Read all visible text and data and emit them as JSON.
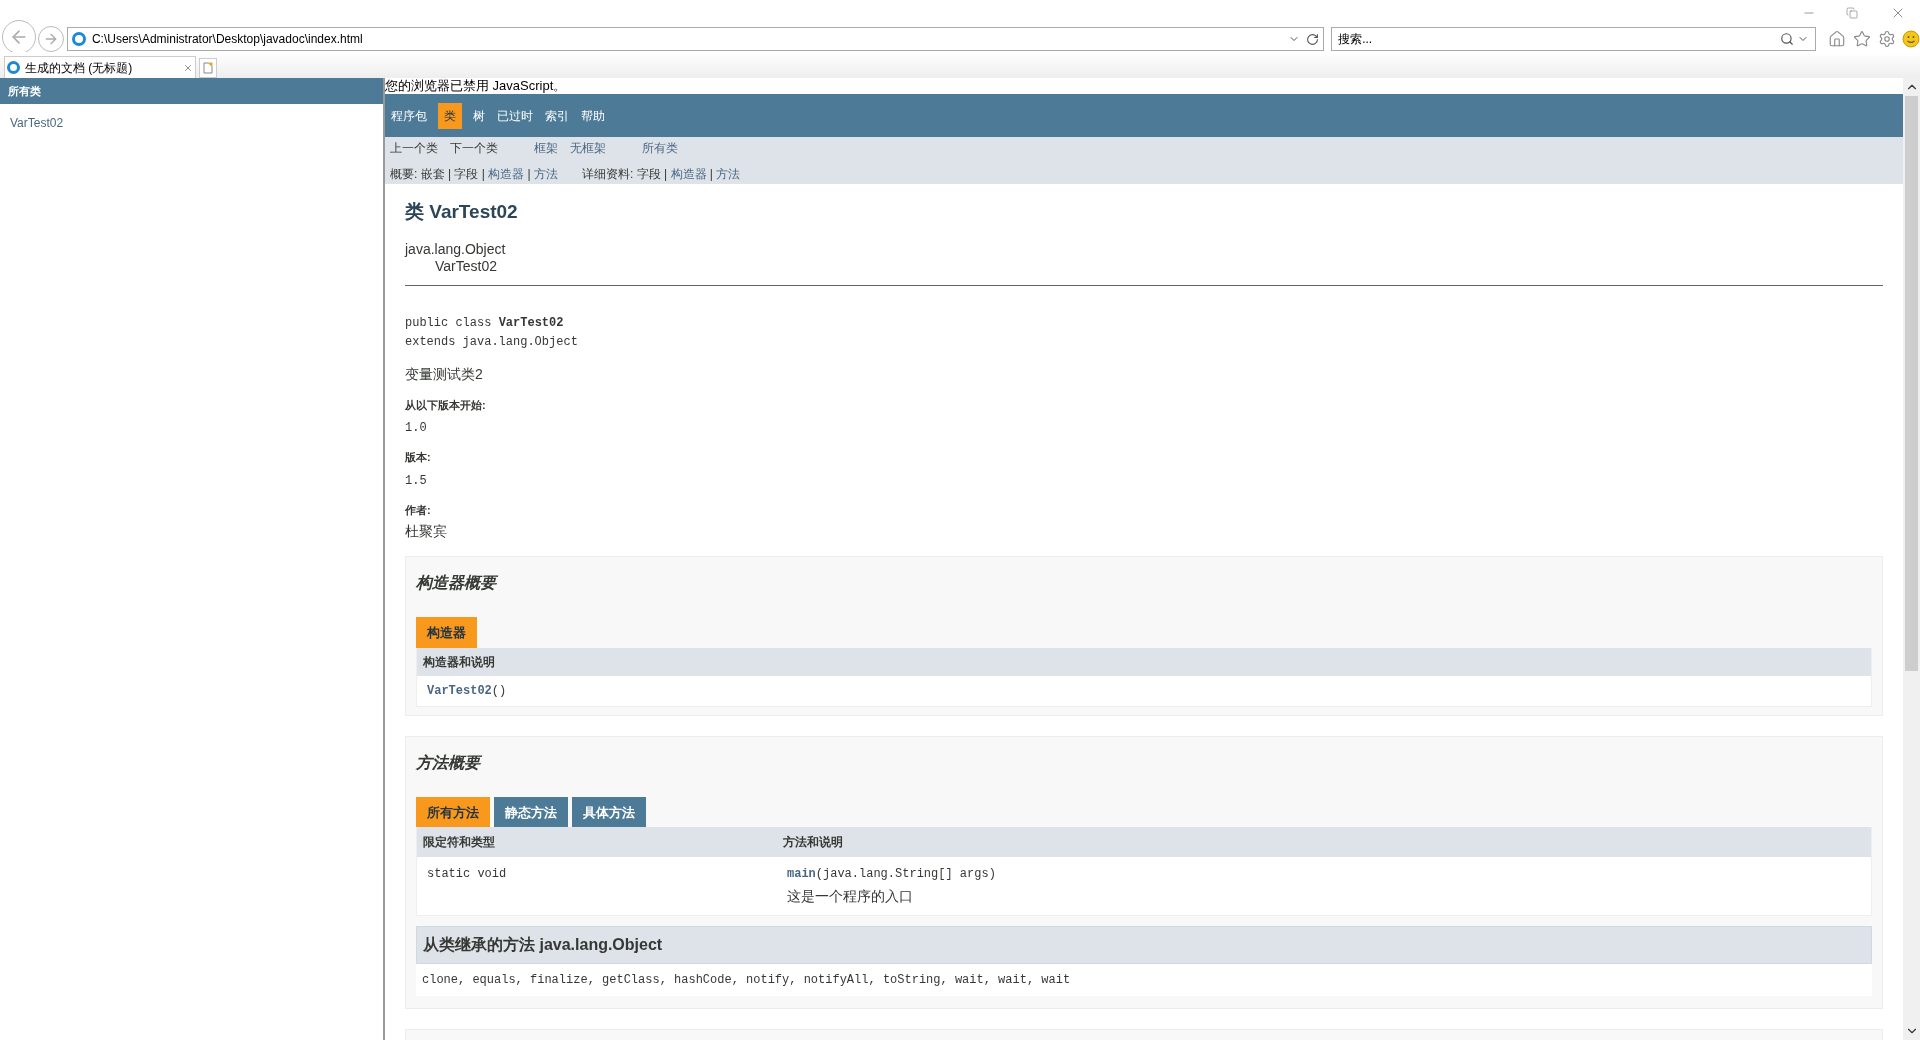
{
  "browser": {
    "address": "C:\\Users\\Administrator\\Desktop\\javadoc\\index.html",
    "search": {
      "placeholder": "搜索..."
    },
    "tabs": [
      {
        "title": "生成的文档 (无标题)",
        "selected": true
      }
    ]
  },
  "left_frame": {
    "heading": "所有类",
    "items": [
      "VarTest02"
    ]
  },
  "noscript": "您的浏览器已禁用 JavaScript。",
  "top_nav": [
    {
      "label": "程序包",
      "selected": false
    },
    {
      "label": "类",
      "selected": true
    },
    {
      "label": "树",
      "selected": false
    },
    {
      "label": "已过时",
      "selected": false
    },
    {
      "label": "索引",
      "selected": false
    },
    {
      "label": "帮助",
      "selected": false
    }
  ],
  "sub_nav": [
    [
      {
        "text": "上一个类",
        "link": false
      },
      {
        "text": "下一个类",
        "link": false
      },
      {
        "text": "框架",
        "link": true
      },
      {
        "text": "无框架",
        "link": true
      },
      {
        "text": "所有类",
        "link": true
      }
    ],
    [
      {
        "text": "概要: 嵌套 | 字段 | ",
        "link": false
      },
      {
        "text": "构造器",
        "link": true
      },
      {
        "text": " | ",
        "link": false
      },
      {
        "text": "方法",
        "link": true
      },
      {
        "text": "详细资料: 字段 | ",
        "link": false
      },
      {
        "text": "构造器",
        "link": true
      },
      {
        "text": " | ",
        "link": false
      },
      {
        "text": "方法",
        "link": true
      }
    ]
  ],
  "class": {
    "title": "类 VarTest02",
    "hierarchy": [
      "java.lang.Object",
      "VarTest02"
    ],
    "signature": [
      "public class **VarTest02**",
      "extends java.lang.Object"
    ],
    "description": "变量测试类2",
    "tags": [
      {
        "label": "从以下版本开始:",
        "value": "1.0",
        "kind": "code"
      },
      {
        "label": "版本:",
        "value": "1.5",
        "kind": "code"
      },
      {
        "label": "作者:",
        "value": "杜聚宾",
        "kind": "text"
      }
    ]
  },
  "constructor_summary": {
    "title": "构造器概要",
    "tabs": [
      {
        "label": "构造器",
        "selected": true
      }
    ],
    "columns": [
      "构造器和说明"
    ],
    "rows": [
      {
        "name": "VarTest02",
        "params": "()"
      }
    ]
  },
  "method_summary": {
    "title": "方法概要",
    "tabs": [
      {
        "label": "所有方法",
        "selected": true
      },
      {
        "label": "静态方法",
        "selected": false
      },
      {
        "label": "具体方法",
        "selected": false
      }
    ],
    "columns": [
      "限定符和类型",
      "方法和说明"
    ],
    "rows": [
      {
        "type": "static void",
        "name": "main",
        "params": "(java.lang.String[] args)",
        "description": "这是一个程序的入口"
      }
    ],
    "inherited_heading": "从类继承的方法 java.lang.Object",
    "inherited": "clone, equals, finalize, getClass, hashCode, notify, notifyAll, toString, wait, wait, wait"
  }
}
